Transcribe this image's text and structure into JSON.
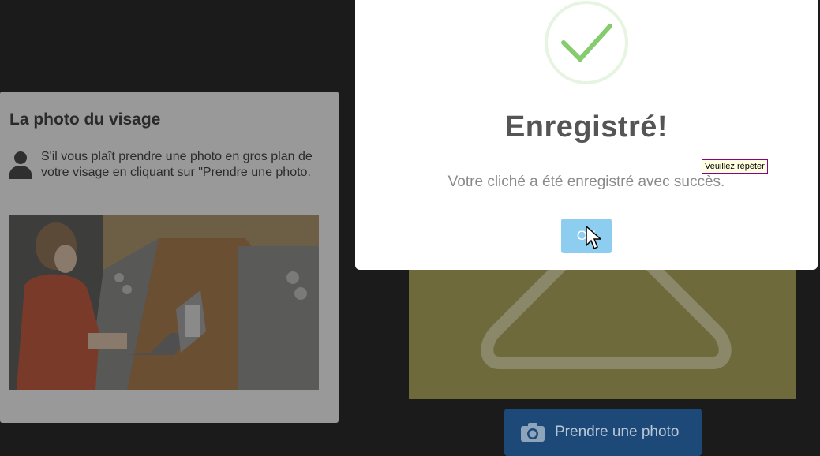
{
  "panel": {
    "title": "La photo du visage",
    "instructions": "S'il vous plaît prendre une photo en gros plan de votre visage en cliquant sur \"Prendre une photo."
  },
  "camera": {
    "take_photo_label": "Prendre une photo"
  },
  "modal": {
    "title": "Enregistré!",
    "message": "Votre cliché a été enregistré avec succès.",
    "ok_label": "OK"
  },
  "tooltip": {
    "text": "Veuillez répéter"
  },
  "colors": {
    "success_green": "#86cc6f",
    "ok_button": "#8ccdf0",
    "take_button": "#1d4978"
  }
}
